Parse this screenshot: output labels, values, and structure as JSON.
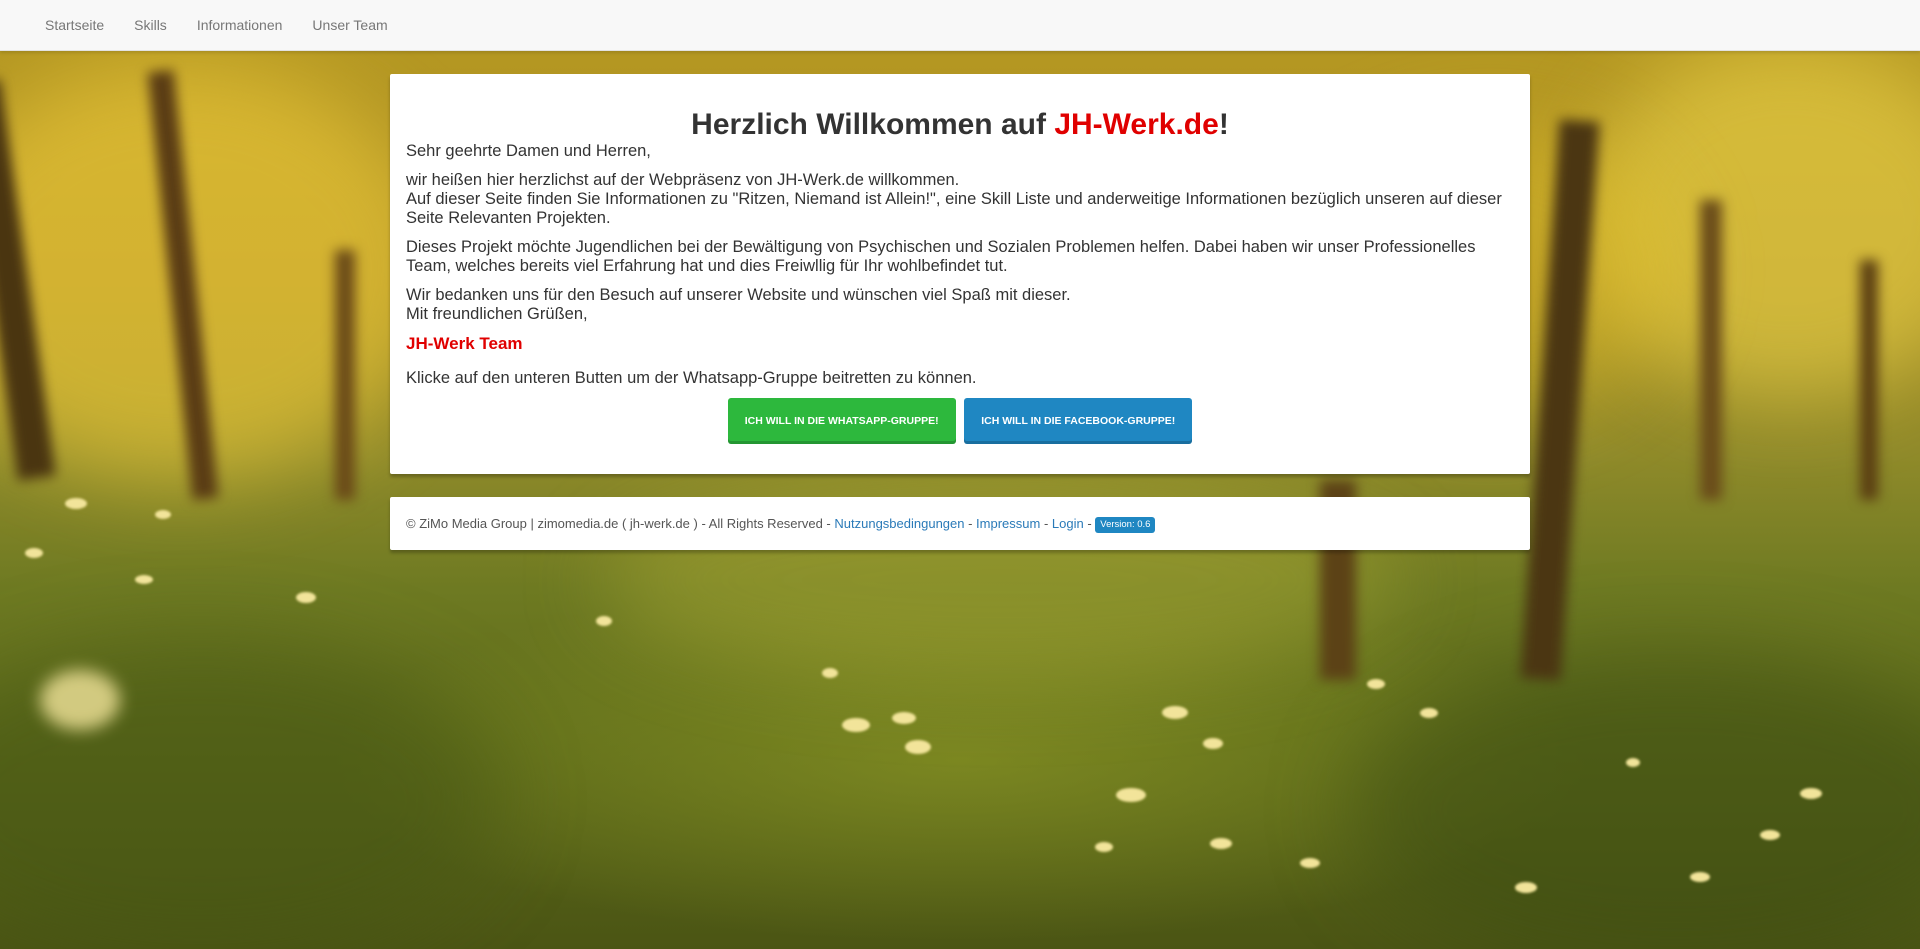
{
  "nav": {
    "items": [
      {
        "label": "Startseite"
      },
      {
        "label": "Skills"
      },
      {
        "label": "Informationen"
      },
      {
        "label": "Unser Team"
      }
    ]
  },
  "welcome": {
    "title_prefix": "Herzlich Willkommen auf ",
    "title_accent": "JH-Werk.de",
    "title_suffix": "!"
  },
  "body": {
    "greeting": "Sehr geehrte Damen und Herren,",
    "intro_line1": "wir heißen hier herzlichst auf der Webpräsenz von JH-Werk.de willkommen.",
    "intro_line2": "Auf dieser Seite finden Sie Informationen zu \"Ritzen, Niemand ist Allein!\", eine Skill Liste und anderweitige Informationen bezüglich unseren auf dieser Seite Relevanten Projekten.",
    "project": "Dieses Projekt möchte Jugendlichen bei der Bewältigung von Psychischen und Sozialen Problemen helfen. Dabei haben wir unser Professionelles Team, welches bereits viel Erfahrung hat und dies Freiwllig für Ihr wohlbefindet tut.",
    "thanks": "Wir bedanken uns für den Besuch auf unserer Website und wünschen viel Spaß mit dieser.",
    "regards": "Mit freundlichen Grüßen,",
    "signature": "JH-Werk Team",
    "cta_text": "Klicke auf den unteren Butten um der Whatsapp-Gruppe beitretten zu können."
  },
  "buttons": {
    "whatsapp_label": "ICH WILL IN DIE WHATSAPP-GRUPPE!",
    "facebook_label": "ICH WILL IN DIE FACEBOOK-GRUPPE!"
  },
  "footer": {
    "copyright": "© ZiMo Media Group | zimomedia.de ( jh-werk.de ) - All Rights Reserved - ",
    "link_terms": "Nutzungsbedingungen",
    "sep1": " - ",
    "link_imprint": "Impressum",
    "sep2": " - ",
    "link_login": "Login",
    "sep3": " - ",
    "version_badge": "Version: 0.6"
  },
  "colors": {
    "accent_red": "#e00000",
    "whatsapp_green": "#2db83d",
    "facebook_blue": "#1f87c2",
    "link_blue": "#2a7ab8"
  }
}
